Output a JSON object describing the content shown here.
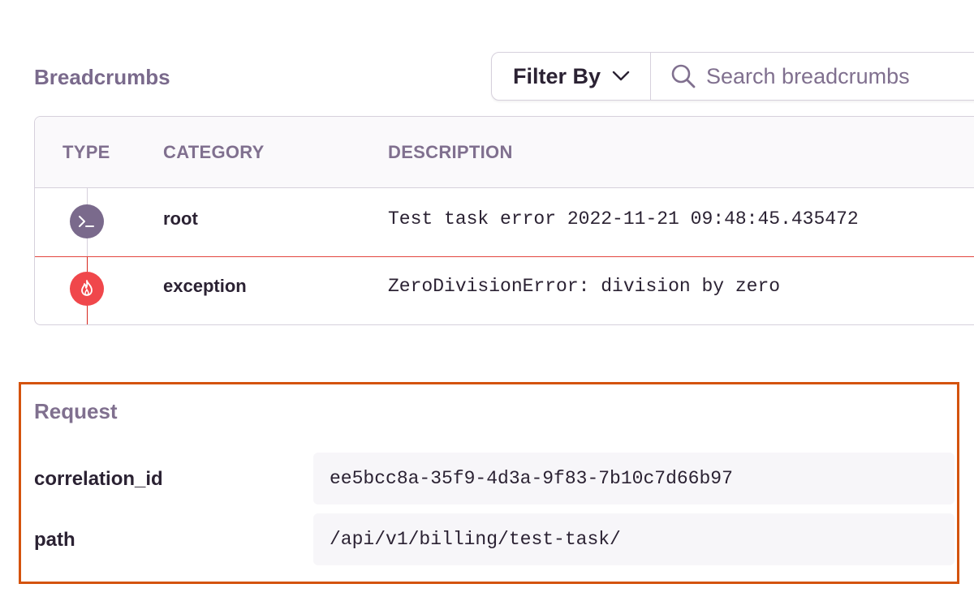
{
  "breadcrumbs": {
    "title": "Breadcrumbs",
    "filter_label": "Filter By",
    "search_placeholder": "Search breadcrumbs",
    "columns": {
      "type": "TYPE",
      "category": "CATEGORY",
      "description": "DESCRIPTION"
    },
    "rows": [
      {
        "type_icon": "terminal-icon",
        "category": "root",
        "description": "Test task error 2022-11-21 09:48:45.435472",
        "color": "#7a6a8c"
      },
      {
        "type_icon": "fire-icon",
        "category": "exception",
        "description_type": "ZeroDivisionError:",
        "description_message": " division by zero",
        "color": "#f0474b"
      }
    ]
  },
  "request": {
    "title": "Request",
    "items": [
      {
        "key": "correlation_id",
        "value": "ee5bcc8a-35f9-4d3a-9f83-7b10c7d66b97"
      },
      {
        "key": "path",
        "value": "/api/v1/billing/test-task/"
      }
    ],
    "highlight_color": "#d4530d"
  }
}
